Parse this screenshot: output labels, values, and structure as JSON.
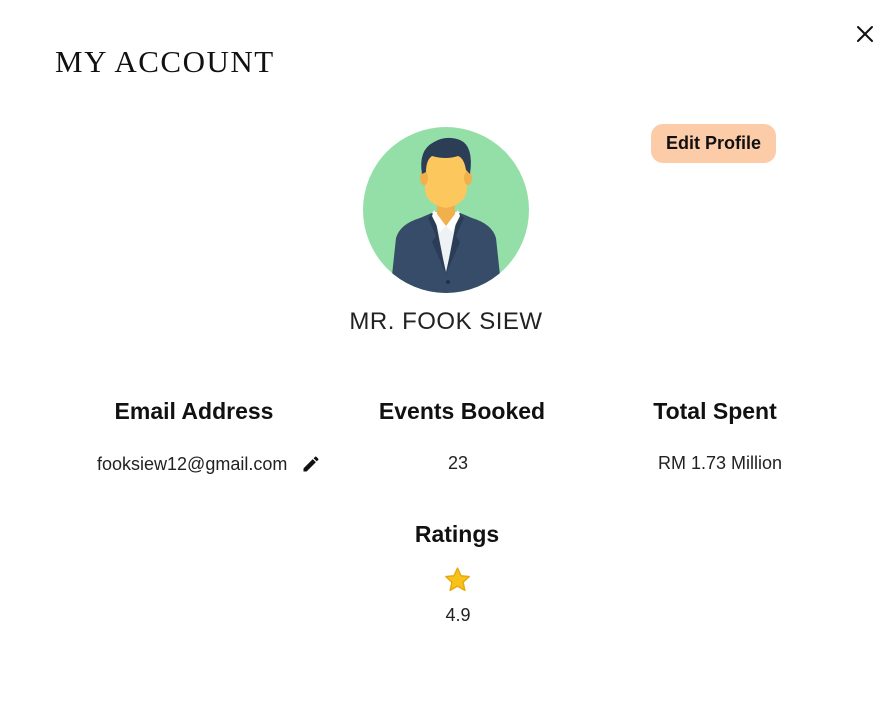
{
  "header": {
    "title": "MY ACCOUNT"
  },
  "profile": {
    "name": "MR. FOOK SIEW",
    "edit_profile_label": "Edit Profile"
  },
  "stats": {
    "email_heading": "Email Address",
    "email_value": "fooksiew12@gmail.com",
    "events_heading": "Events Booked",
    "events_value": "23",
    "spent_heading": "Total Spent",
    "spent_value": "RM 1.73 Million"
  },
  "ratings": {
    "heading": "Ratings",
    "value": "4.9"
  },
  "icons": {
    "close": "close-icon",
    "edit": "pencil-icon",
    "star": "star-icon",
    "avatar": "person-avatar"
  },
  "colors": {
    "edit_button_bg": "#fccba7",
    "avatar_bg": "#94dfa8",
    "star": "#f8c21c"
  }
}
